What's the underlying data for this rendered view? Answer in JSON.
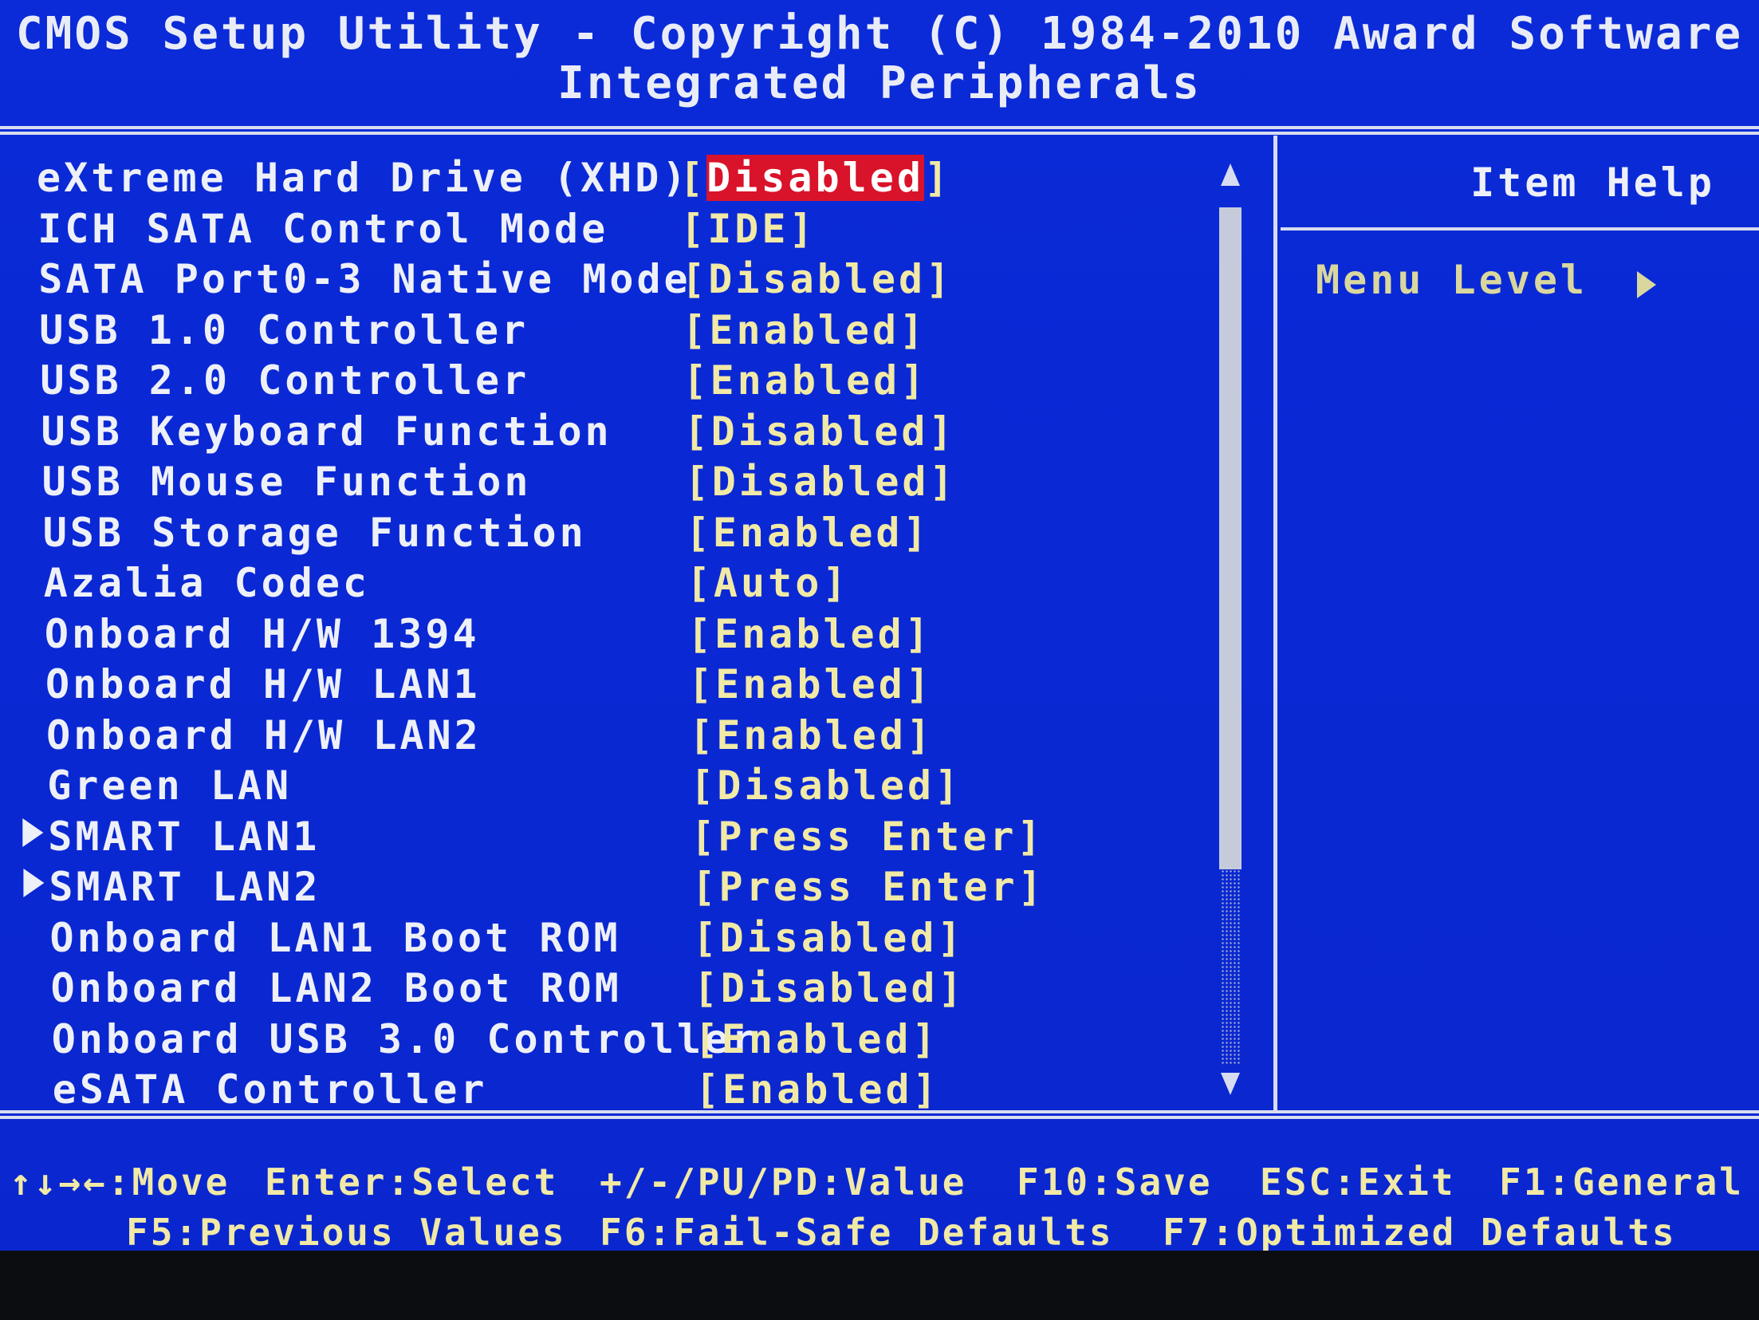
{
  "header": {
    "title": "CMOS Setup Utility - Copyright (C) 1984-2010 Award Software",
    "subtitle": "Integrated Peripherals"
  },
  "settings": [
    {
      "label": "eXtreme Hard Drive (XHD)",
      "value": "Disabled",
      "selected": true,
      "submenu": false
    },
    {
      "label": "ICH SATA Control Mode",
      "value": "IDE",
      "selected": false,
      "submenu": false
    },
    {
      "label": "SATA Port0-3 Native Mode",
      "value": "Disabled",
      "selected": false,
      "submenu": false
    },
    {
      "label": "USB 1.0 Controller",
      "value": "Enabled",
      "selected": false,
      "submenu": false
    },
    {
      "label": "USB 2.0 Controller",
      "value": "Enabled",
      "selected": false,
      "submenu": false
    },
    {
      "label": "USB Keyboard Function",
      "value": "Disabled",
      "selected": false,
      "submenu": false
    },
    {
      "label": "USB Mouse Function",
      "value": "Disabled",
      "selected": false,
      "submenu": false
    },
    {
      "label": "USB Storage Function",
      "value": "Enabled",
      "selected": false,
      "submenu": false
    },
    {
      "label": "Azalia Codec",
      "value": "Auto",
      "selected": false,
      "submenu": false
    },
    {
      "label": "Onboard H/W 1394",
      "value": "Enabled",
      "selected": false,
      "submenu": false
    },
    {
      "label": "Onboard H/W LAN1",
      "value": "Enabled",
      "selected": false,
      "submenu": false
    },
    {
      "label": "Onboard H/W LAN2",
      "value": "Enabled",
      "selected": false,
      "submenu": false
    },
    {
      "label": "Green LAN",
      "value": "Disabled",
      "selected": false,
      "submenu": false
    },
    {
      "label": "SMART LAN1",
      "value": "Press Enter",
      "selected": false,
      "submenu": true
    },
    {
      "label": "SMART LAN2",
      "value": "Press Enter",
      "selected": false,
      "submenu": true
    },
    {
      "label": "Onboard LAN1 Boot ROM",
      "value": "Disabled",
      "selected": false,
      "submenu": false
    },
    {
      "label": "Onboard LAN2 Boot ROM",
      "value": "Disabled",
      "selected": false,
      "submenu": false
    },
    {
      "label": "Onboard USB 3.0 Controller",
      "value": "Enabled",
      "selected": false,
      "submenu": false
    },
    {
      "label": "eSATA Controller",
      "value": "Enabled",
      "selected": false,
      "submenu": false
    }
  ],
  "help_panel": {
    "title": "Item Help",
    "menu_level_label": "Menu Level",
    "menu_level_icon": "right-triangle-icon"
  },
  "footer": {
    "line1": [
      {
        "key": "↑↓→←",
        "action": "Move"
      },
      {
        "key": "Enter",
        "action": "Select"
      },
      {
        "key": "+/-/PU/PD",
        "action": "Value"
      },
      {
        "key": "F10",
        "action": "Save"
      },
      {
        "key": "ESC",
        "action": "Exit"
      },
      {
        "key": "F1",
        "action": "General"
      }
    ],
    "line2": [
      {
        "key": "F5",
        "action": "Previous Values"
      },
      {
        "key": "F6",
        "action": "Fail-Safe Defaults"
      },
      {
        "key": "F7",
        "action": "Optimized Defaults"
      }
    ]
  },
  "colors": {
    "background": "#0a28d4",
    "label_text": "#eef0f8",
    "value_text": "#f1e9a6",
    "selection": "#d8132a"
  }
}
